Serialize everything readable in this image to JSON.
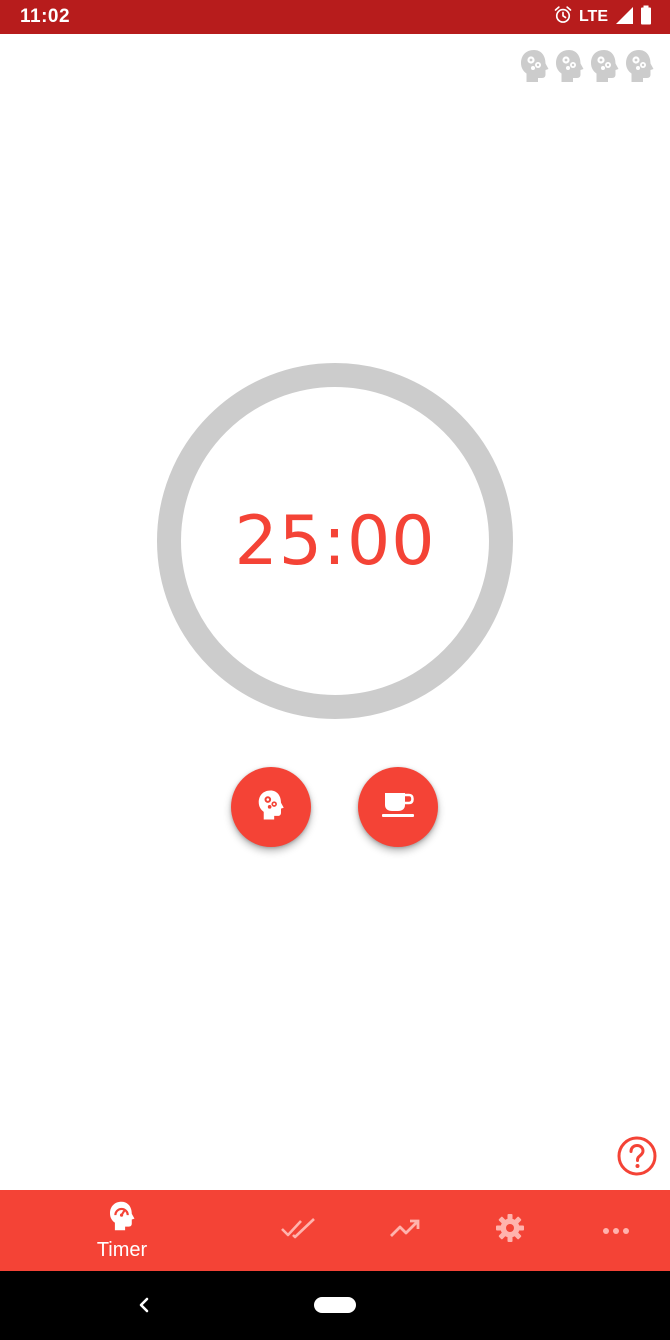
{
  "status_bar": {
    "time": "11:02",
    "network": "LTE",
    "icons": [
      "alarm-icon",
      "signal-icon",
      "battery-icon"
    ],
    "background_color": "#b71c1c"
  },
  "streak": {
    "count": 4,
    "icon": "head-gears-icon",
    "color": "#cccccc"
  },
  "timer": {
    "display": "25:00",
    "progress": 0,
    "ring_color": "#cccccc",
    "text_color": "#f44336"
  },
  "actions": {
    "work_icon": "head-gears-icon",
    "break_icon": "coffee-cup-icon",
    "accent_color": "#f44336"
  },
  "help": {
    "icon": "help-circle-icon"
  },
  "bottom_nav": {
    "items": [
      {
        "label": "Timer",
        "icon": "head-gauge-icon",
        "selected": true
      },
      {
        "label": "",
        "icon": "double-check-icon",
        "selected": false
      },
      {
        "label": "",
        "icon": "trending-up-icon",
        "selected": false
      },
      {
        "label": "",
        "icon": "gear-icon",
        "selected": false
      },
      {
        "label": "",
        "icon": "more-horizontal-icon",
        "selected": false
      }
    ],
    "background_color": "#f44336"
  },
  "system_nav": {
    "icons": [
      "back-icon",
      "home-pill-icon"
    ]
  }
}
